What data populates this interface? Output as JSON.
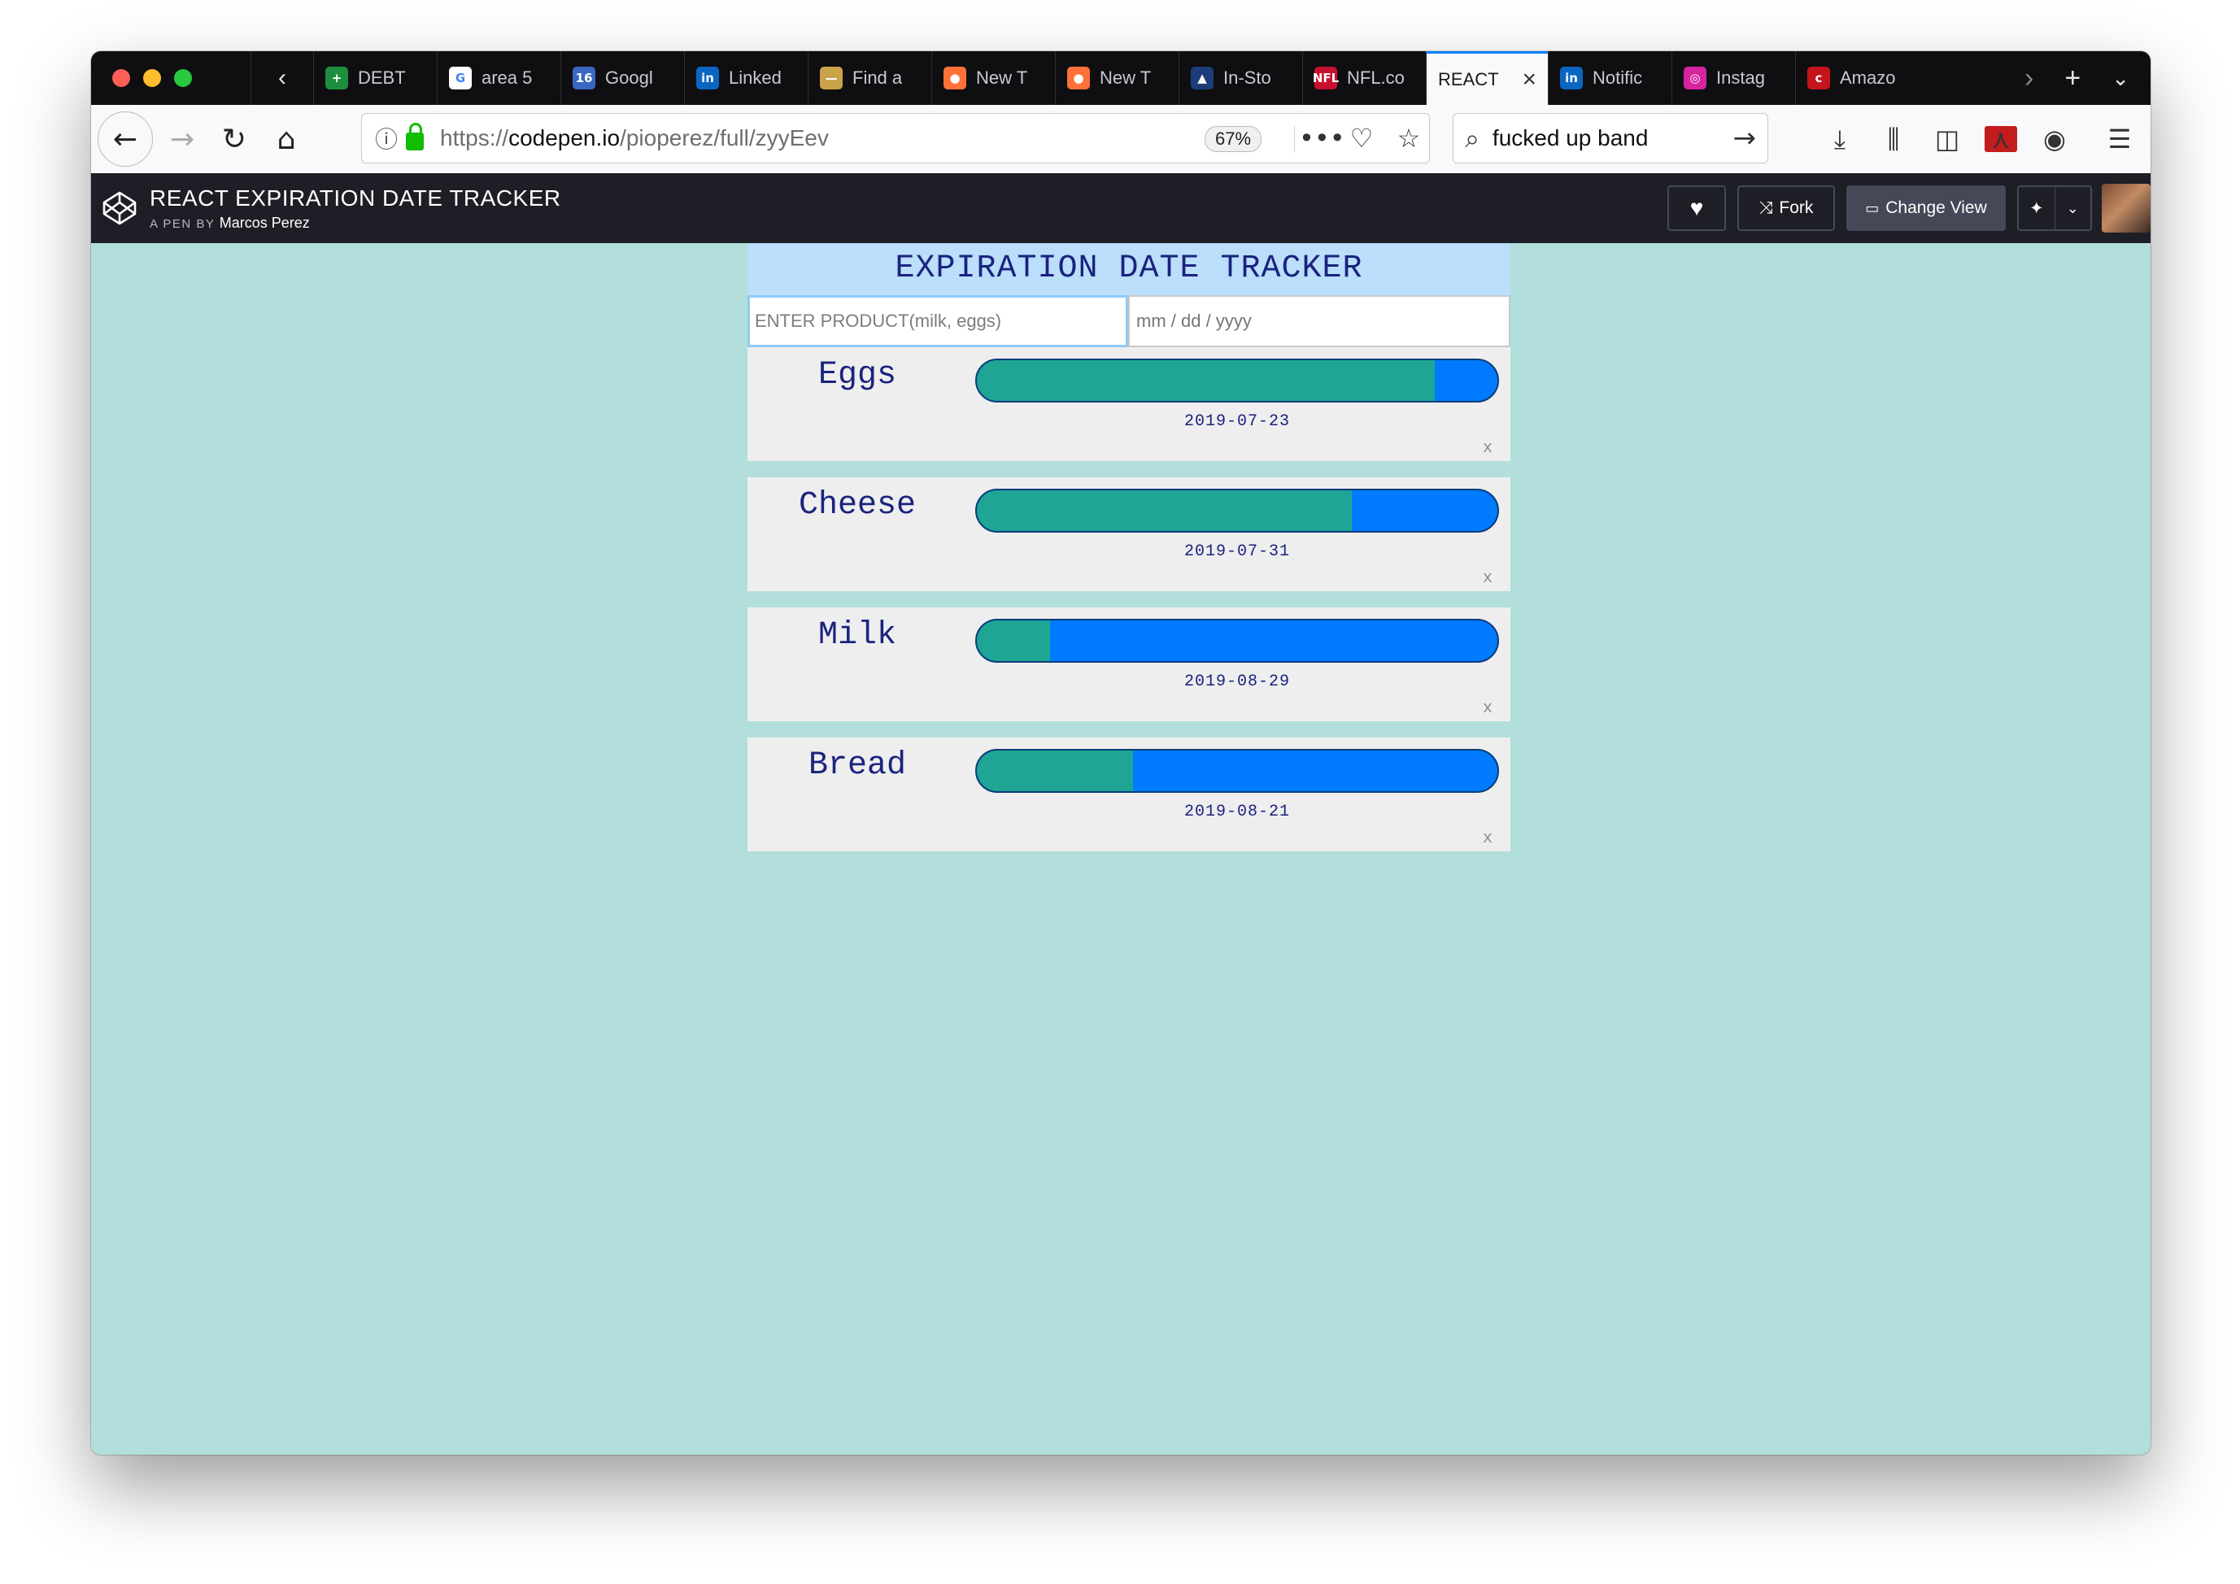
{
  "browser": {
    "tabs": [
      {
        "label": "DEBT",
        "favicon": "sheets-icon",
        "color": "#1e8e3e",
        "glyph": "+"
      },
      {
        "label": "area 5",
        "favicon": "google-icon",
        "color": "#ffffff",
        "glyph": "G"
      },
      {
        "label": "Googl",
        "favicon": "calendar-icon",
        "color": "#3a66c4",
        "glyph": "16"
      },
      {
        "label": "Linked",
        "favicon": "linkedin-icon",
        "color": "#0a66c2",
        "glyph": "in"
      },
      {
        "label": "Find a",
        "favicon": "chevrolet-icon",
        "color": "#c9a24a",
        "glyph": "—"
      },
      {
        "label": "New T",
        "favicon": "firefox-icon",
        "color": "#ff7139",
        "glyph": "●"
      },
      {
        "label": "New T",
        "favicon": "firefox-icon",
        "color": "#ff7139",
        "glyph": "●"
      },
      {
        "label": "In-Sto",
        "favicon": "mountain-icon",
        "color": "#1c3d7a",
        "glyph": "▲"
      },
      {
        "label": "NFL.co",
        "favicon": "nfl-icon",
        "color": "#c8102e",
        "glyph": "NFL"
      },
      {
        "label": "REACT",
        "favicon": "",
        "color": "#ffffff",
        "glyph": "",
        "active": true
      },
      {
        "label": "Notific",
        "favicon": "linkedin-icon",
        "color": "#0a66c2",
        "glyph": "in"
      },
      {
        "label": "Instag",
        "favicon": "instagram-icon",
        "color": "#d6249f",
        "glyph": "◎"
      },
      {
        "label": "Amazo",
        "favicon": "cnet-icon",
        "color": "#c4151c",
        "glyph": "c"
      }
    ],
    "url_prefix": "https://",
    "url_domain": "codepen.io",
    "url_path": "/pioperez/full/zyyEev",
    "zoom": "67%",
    "search_value": "fucked up band"
  },
  "codepen": {
    "title": "REACT EXPIRATION DATE TRACKER",
    "byline": "A PEN BY",
    "author": "Marcos Perez",
    "fork_label": "Fork",
    "change_view_label": "Change View"
  },
  "app": {
    "title": "EXPIRATION DATE TRACKER",
    "product_placeholder": "ENTER PRODUCT(milk, eggs)",
    "date_placeholder": "mm / dd / yyyy",
    "remove_label": "x",
    "items": [
      {
        "name": "Eggs",
        "date": "2019-07-23",
        "progress": 0.88
      },
      {
        "name": "Cheese",
        "date": "2019-07-31",
        "progress": 0.72
      },
      {
        "name": "Milk",
        "date": "2019-08-29",
        "progress": 0.14
      },
      {
        "name": "Bread",
        "date": "2019-08-21",
        "progress": 0.3
      }
    ]
  }
}
